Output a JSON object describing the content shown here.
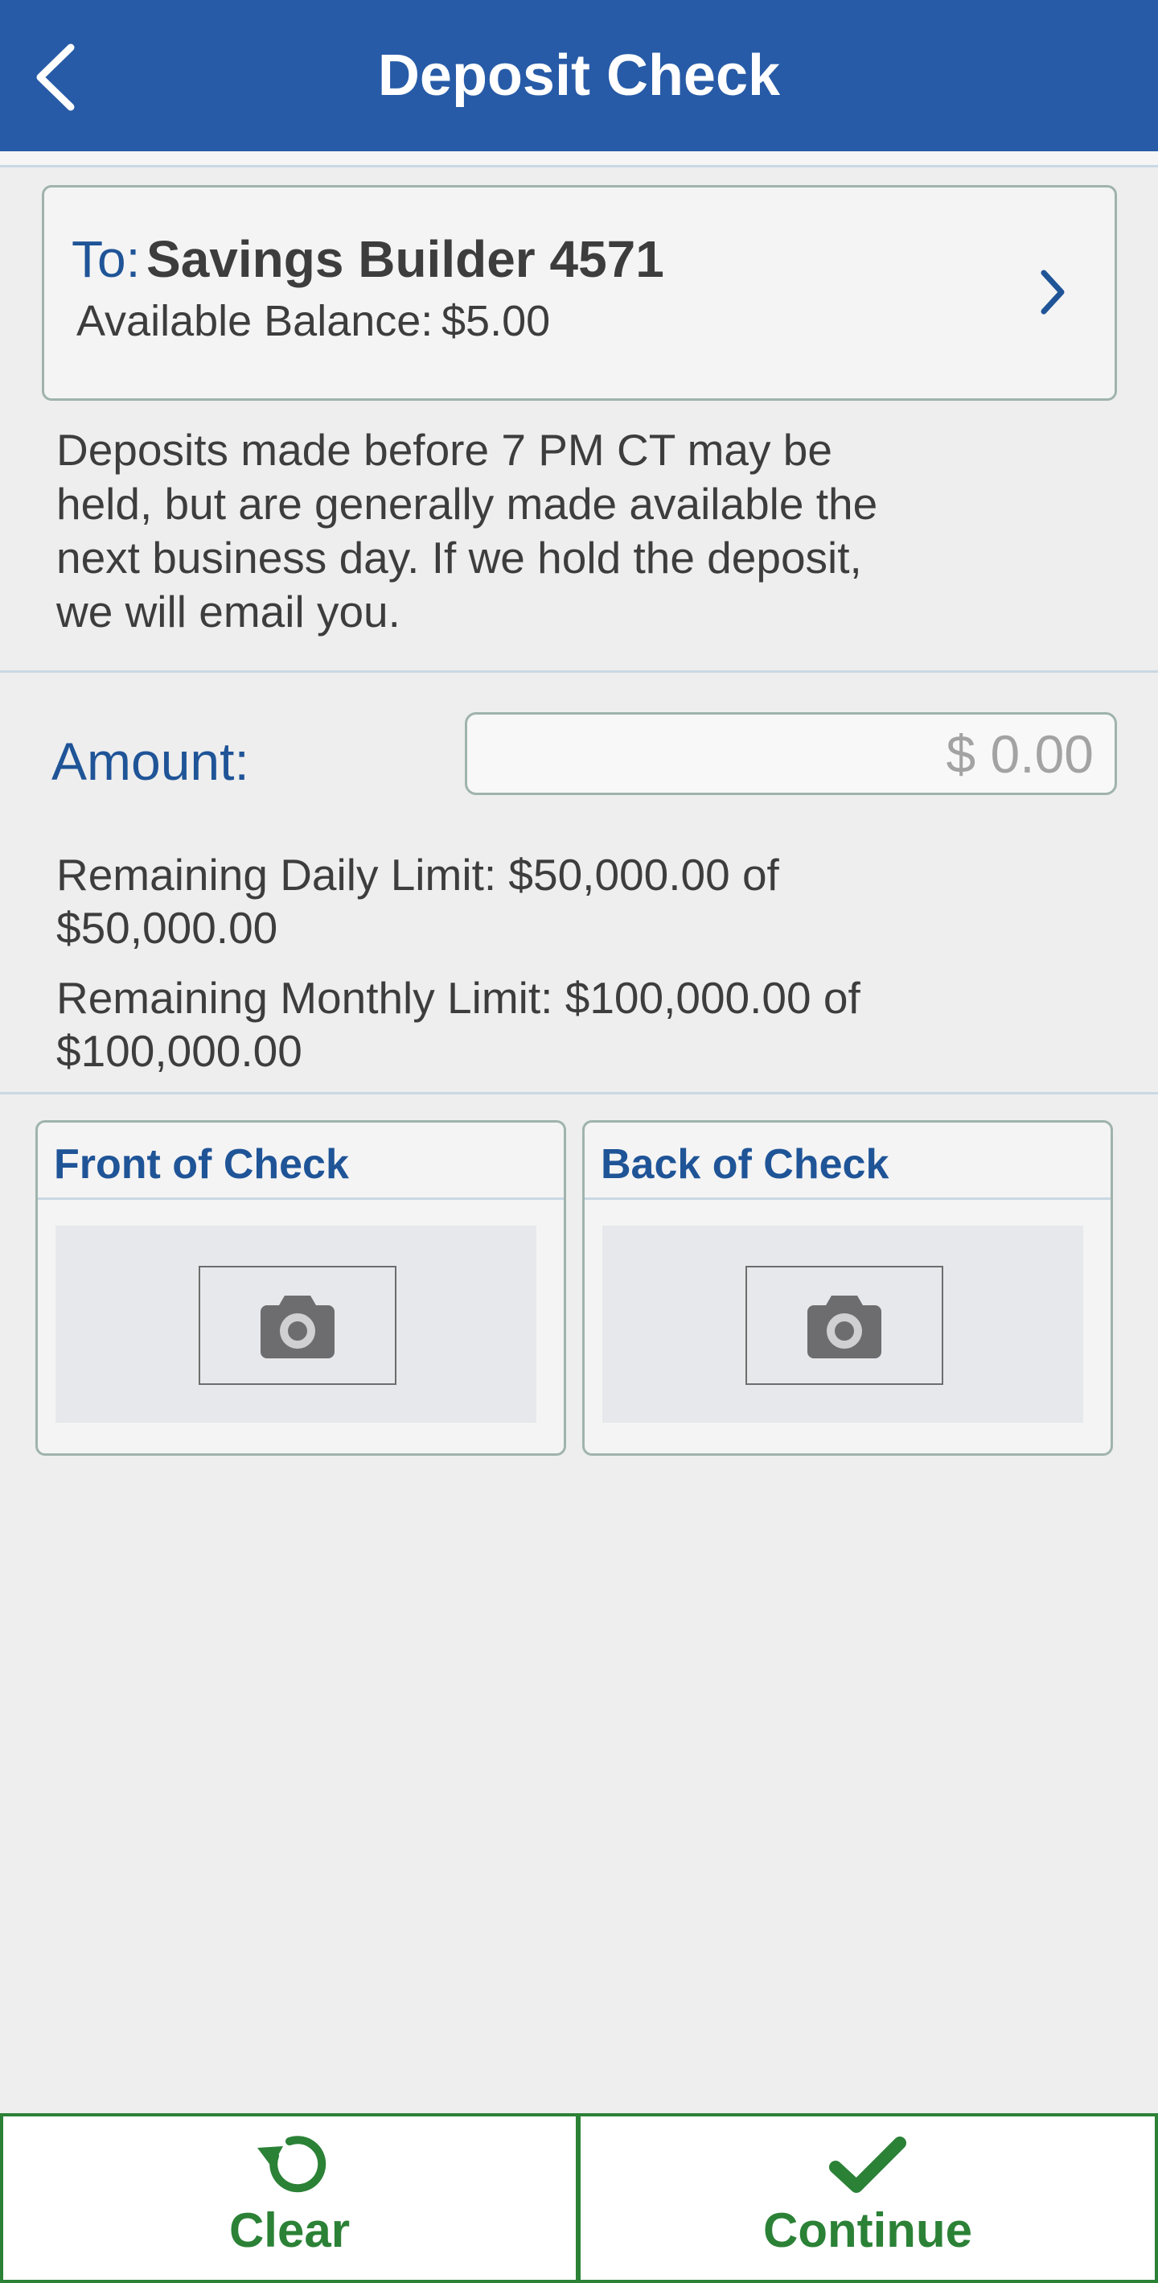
{
  "header": {
    "title": "Deposit Check",
    "back_icon": "chevron-left-icon"
  },
  "to_account": {
    "prefix": "To:",
    "account_name": "Savings Builder 4571",
    "balance_label": "Available Balance:",
    "balance_value": "$5.00",
    "chevron_icon": "chevron-right-icon"
  },
  "notice": "Deposits made before 7 PM CT may be held, but are generally made available the next business day. If we hold the deposit, we will email you.",
  "amount": {
    "label": "Amount:",
    "placeholder": "$ 0.00",
    "value": ""
  },
  "limits": {
    "daily": "Remaining Daily Limit: $50,000.00 of $50,000.00",
    "monthly": "Remaining Monthly Limit: $100,000.00 of $100,000.00"
  },
  "check_images": [
    {
      "title": "Front of Check",
      "icon": "camera-icon"
    },
    {
      "title": "Back of Check",
      "icon": "camera-icon"
    }
  ],
  "actions": {
    "clear_label": "Clear",
    "clear_icon": "refresh-icon",
    "continue_label": "Continue",
    "continue_icon": "checkmark-icon"
  },
  "colors": {
    "header_bg": "#275ba7",
    "accent_blue": "#1f5497",
    "action_green": "#2b8136",
    "border": "#9fb3ac"
  }
}
